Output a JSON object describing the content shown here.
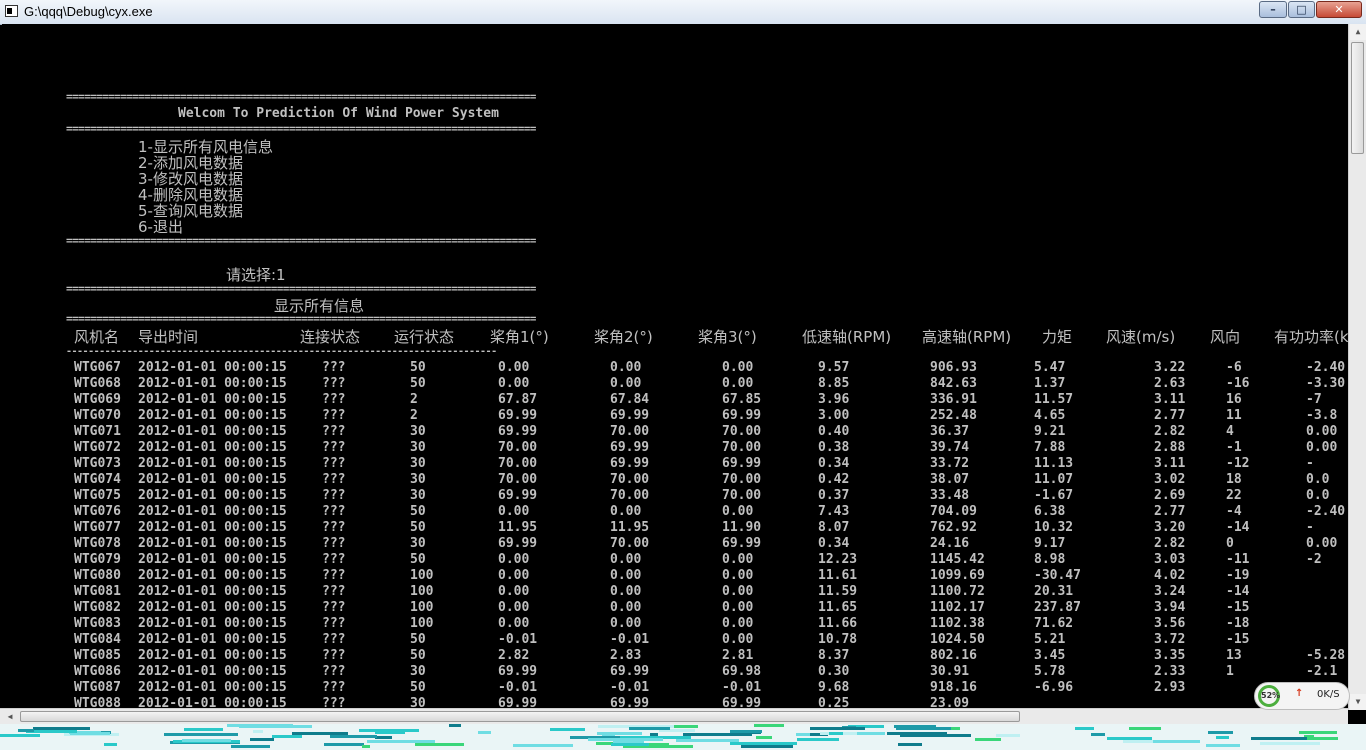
{
  "window": {
    "title": "G:\\qqq\\Debug\\cyx.exe",
    "min": "–",
    "max": "□",
    "close": "✕"
  },
  "menu": {
    "rule": "==============================================================================",
    "heading": "Welcom To Prediction Of Wind Power System",
    "items": [
      "1-显示所有风电信息",
      "2-添加风电数据",
      "3-修改风电数据",
      "4-删除风电数据",
      "5-查询风电数据",
      "6-退出"
    ],
    "prompt": "请选择:1",
    "section_title": "显示所有信息",
    "dash_rule": "------------------------------------------------------------------------------"
  },
  "table": {
    "headers": [
      "风机名",
      "导出时间",
      "连接状态",
      "运行状态",
      "桨角1(°)",
      "桨角2(°)",
      "桨角3(°)",
      "低速轴(RPM)",
      "高速轴(RPM)",
      "力矩",
      "风速(m/s)",
      "风向",
      "有功功率(k"
    ],
    "rows": [
      [
        "WTG067",
        "2012-01-01 00:00:15",
        "???",
        "50",
        "0.00",
        "0.00",
        "0.00",
        "9.57",
        "906.93",
        "5.47",
        "3.22",
        "-6",
        "-2.40"
      ],
      [
        "WTG068",
        "2012-01-01 00:00:15",
        "???",
        "50",
        "0.00",
        "0.00",
        "0.00",
        "8.85",
        "842.63",
        "1.37",
        "2.63",
        "-16",
        "-3.30"
      ],
      [
        "WTG069",
        "2012-01-01 00:00:15",
        "???",
        "2",
        "67.87",
        "67.84",
        "67.85",
        "3.96",
        "336.91",
        "11.57",
        "3.11",
        "16",
        "-7"
      ],
      [
        "WTG070",
        "2012-01-01 00:00:15",
        "???",
        "2",
        "69.99",
        "69.99",
        "69.99",
        "3.00",
        "252.48",
        "4.65",
        "2.77",
        "11",
        "-3.8"
      ],
      [
        "WTG071",
        "2012-01-01 00:00:15",
        "???",
        "30",
        "69.99",
        "70.00",
        "70.00",
        "0.40",
        "36.37",
        "9.21",
        "2.82",
        "4",
        "0.00"
      ],
      [
        "WTG072",
        "2012-01-01 00:00:15",
        "???",
        "30",
        "70.00",
        "69.99",
        "70.00",
        "0.38",
        "39.74",
        "7.88",
        "2.88",
        "-1",
        "0.00"
      ],
      [
        "WTG073",
        "2012-01-01 00:00:15",
        "???",
        "30",
        "70.00",
        "69.99",
        "69.99",
        "0.34",
        "33.72",
        "11.13",
        "3.11",
        "-12",
        "-"
      ],
      [
        "WTG074",
        "2012-01-01 00:00:15",
        "???",
        "30",
        "70.00",
        "70.00",
        "70.00",
        "0.42",
        "38.07",
        "11.07",
        "3.02",
        "18",
        "0.0"
      ],
      [
        "WTG075",
        "2012-01-01 00:00:15",
        "???",
        "30",
        "69.99",
        "70.00",
        "70.00",
        "0.37",
        "33.48",
        "-1.67",
        "2.69",
        "22",
        "0.0"
      ],
      [
        "WTG076",
        "2012-01-01 00:00:15",
        "???",
        "50",
        "0.00",
        "0.00",
        "0.00",
        "7.43",
        "704.09",
        "6.38",
        "2.77",
        "-4",
        "-2.40"
      ],
      [
        "WTG077",
        "2012-01-01 00:00:15",
        "???",
        "50",
        "11.95",
        "11.95",
        "11.90",
        "8.07",
        "762.92",
        "10.32",
        "3.20",
        "-14",
        "-"
      ],
      [
        "WTG078",
        "2012-01-01 00:00:15",
        "???",
        "30",
        "69.99",
        "70.00",
        "69.99",
        "0.34",
        "24.16",
        "9.17",
        "2.82",
        "0",
        "0.00"
      ],
      [
        "WTG079",
        "2012-01-01 00:00:15",
        "???",
        "50",
        "0.00",
        "0.00",
        "0.00",
        "12.23",
        "1145.42",
        "8.98",
        "3.03",
        "-11",
        "-2"
      ],
      [
        "WTG080",
        "2012-01-01 00:00:15",
        "???",
        "100",
        "0.00",
        "0.00",
        "0.00",
        "11.61",
        "1099.69",
        "-30.47",
        "4.02",
        "-19",
        ""
      ],
      [
        "WTG081",
        "2012-01-01 00:00:15",
        "???",
        "100",
        "0.00",
        "0.00",
        "0.00",
        "11.59",
        "1100.72",
        "20.31",
        "3.24",
        "-14",
        ""
      ],
      [
        "WTG082",
        "2012-01-01 00:00:15",
        "???",
        "100",
        "0.00",
        "0.00",
        "0.00",
        "11.65",
        "1102.17",
        "237.87",
        "3.94",
        "-15",
        ""
      ],
      [
        "WTG083",
        "2012-01-01 00:00:15",
        "???",
        "100",
        "0.00",
        "0.00",
        "0.00",
        "11.66",
        "1102.38",
        "71.62",
        "3.56",
        "-18",
        ""
      ],
      [
        "WTG084",
        "2012-01-01 00:00:15",
        "???",
        "50",
        "-0.01",
        "-0.01",
        "0.00",
        "10.78",
        "1024.50",
        "5.21",
        "3.72",
        "-15",
        ""
      ],
      [
        "WTG085",
        "2012-01-01 00:00:15",
        "???",
        "50",
        "2.82",
        "2.83",
        "2.81",
        "8.37",
        "802.16",
        "3.45",
        "3.35",
        "13",
        "-5.28"
      ],
      [
        "WTG086",
        "2012-01-01 00:00:15",
        "???",
        "30",
        "69.99",
        "69.99",
        "69.98",
        "0.30",
        "30.91",
        "5.78",
        "2.33",
        "1",
        "-2.1"
      ],
      [
        "WTG087",
        "2012-01-01 00:00:15",
        "???",
        "50",
        "-0.01",
        "-0.01",
        "-0.01",
        "9.68",
        "918.16",
        "-6.96",
        "2.93",
        "",
        ""
      ],
      [
        "WTG088",
        "2012-01-01 00:00:15",
        "???",
        "30",
        "69.99",
        "69.99",
        "69.99",
        "0.25",
        "23.09",
        "",
        "",
        "",
        ""
      ]
    ]
  },
  "net_widget": {
    "percent": "52%",
    "arrow": "↑",
    "rate": "0K/S"
  },
  "colors": {
    "console_bg": "#000000",
    "console_text": "#c0c0c0",
    "title_bg": "#dde7f3",
    "close_btn": "#c64a36"
  }
}
